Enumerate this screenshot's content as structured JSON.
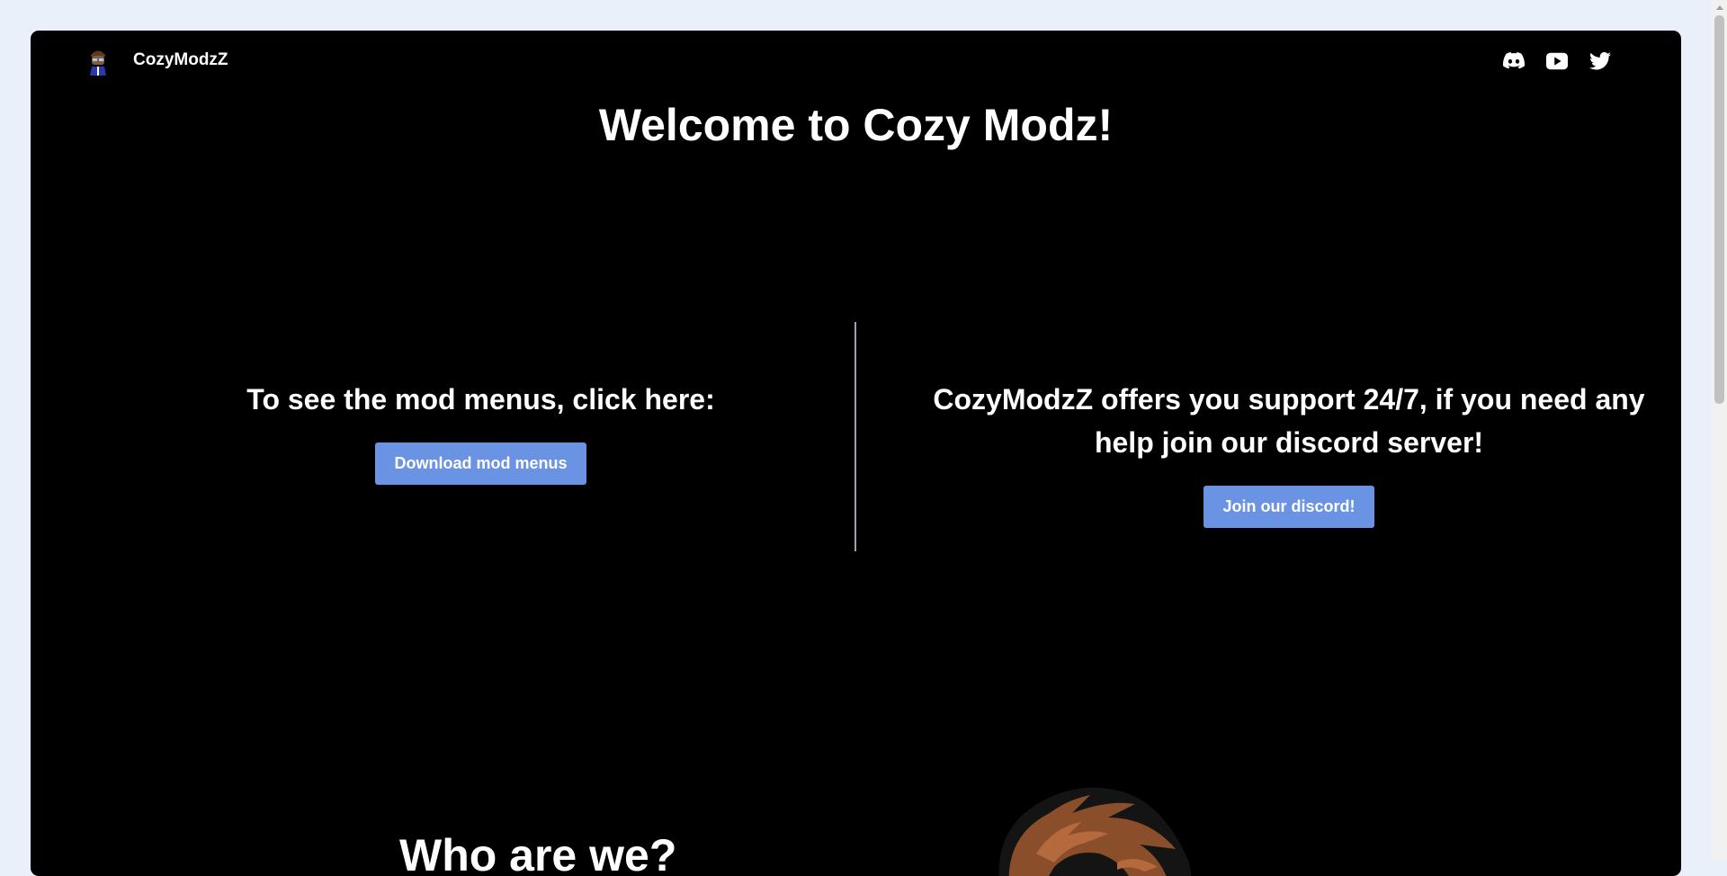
{
  "header": {
    "brand_name": "CozyModzZ",
    "logo_icon": "avatar-logo-icon",
    "social_icons": [
      "discord-icon",
      "youtube-icon",
      "twitter-icon"
    ]
  },
  "hero": {
    "title": "Welcome to Cozy Modz!"
  },
  "left_panel": {
    "text": "To see the mod menus, click here:",
    "button_label": "Download mod menus"
  },
  "right_panel": {
    "text": "CozyModzZ offers you support 24/7, if you need any help join our discord server!",
    "button_label": "Join our discord!"
  },
  "about": {
    "title": "Who are we?",
    "image_icon": "mascot-image"
  },
  "colors": {
    "page_background": "#eaf0fa",
    "card_background": "#000000",
    "accent_button": "#6a93e4",
    "text": "#ffffff"
  }
}
